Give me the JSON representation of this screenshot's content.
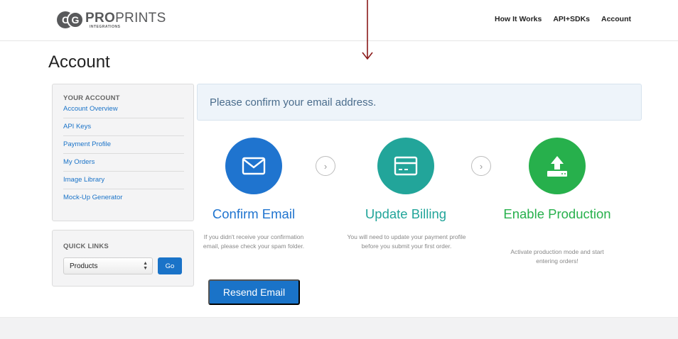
{
  "logo": {
    "mark": "CG",
    "brand_bold": "PRO",
    "brand_light": "PRINTS",
    "sub": "INTEGRATIONS"
  },
  "nav": {
    "items": [
      "How It Works",
      "API+SDKs",
      "Account"
    ]
  },
  "page": {
    "title": "Account"
  },
  "sidebar": {
    "heading": "YOUR ACCOUNT",
    "items": [
      "Account Overview",
      "API Keys",
      "Payment Profile",
      "My Orders",
      "Image Library",
      "Mock-Up Generator"
    ]
  },
  "quick_links": {
    "heading": "QUICK LINKS",
    "select_value": "Products",
    "go_label": "Go"
  },
  "alert": {
    "text": "Please confirm your email address."
  },
  "steps": [
    {
      "title": "Confirm Email",
      "text": "If you didn't receive your confirmation email, please check your spam folder.",
      "icon": "envelope-icon",
      "color": "#1f74cf"
    },
    {
      "title": "Update Billing",
      "text": "You will need to update your payment profile before you submit your first order.",
      "icon": "credit-card-icon",
      "color": "#22a59a"
    },
    {
      "title": "Enable Production",
      "text": "Activate production mode and start entering orders!",
      "icon": "upload-icon",
      "color": "#27b04c"
    }
  ],
  "resend": {
    "label": "Resend Email"
  },
  "colors": {
    "accent": "#1a73c8",
    "annotation_arrow": "#8b1a1a"
  }
}
